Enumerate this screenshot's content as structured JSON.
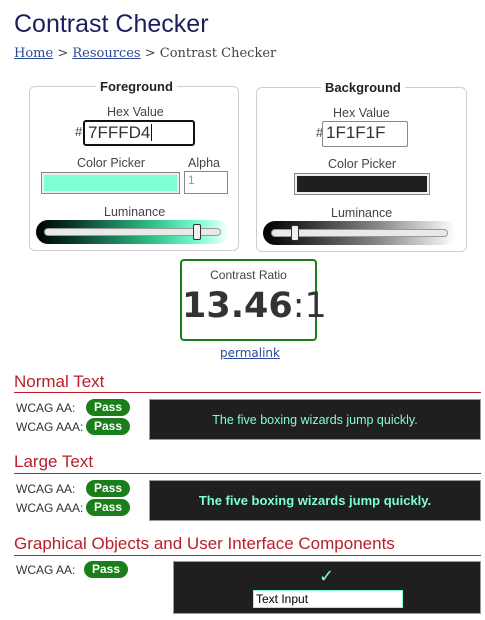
{
  "page": {
    "title": "Contrast Checker",
    "breadcrumb": {
      "home": "Home",
      "sep1": ">",
      "resources": "Resources",
      "sep2": ">",
      "current": "Contrast Checker"
    }
  },
  "foreground": {
    "legend": "Foreground",
    "hex_label": "Hex Value",
    "hash": "#",
    "hex_value": "7FFFD4",
    "picker_label": "Color Picker",
    "alpha_label": "Alpha",
    "alpha_placeholder": "1",
    "luminance_label": "Luminance",
    "luminance_level": 0.88,
    "color": "#7fffd4"
  },
  "background": {
    "legend": "Background",
    "hex_label": "Hex Value",
    "hash": "#",
    "hex_value": "1F1F1F",
    "picker_label": "Color Picker",
    "luminance_label": "Luminance",
    "luminance_level": 0.12,
    "color": "#1f1f1f"
  },
  "result": {
    "label": "Contrast Ratio",
    "ratio": "13.46",
    "colon": ":",
    "one": "1",
    "permalink": "permalink"
  },
  "sections": {
    "normal": {
      "title": "Normal Text",
      "aa": "WCAG AA:",
      "aaa": "WCAG AAA:",
      "aa_result": "Pass",
      "aaa_result": "Pass",
      "sample": "The five boxing wizards jump quickly."
    },
    "large": {
      "title": "Large Text",
      "aa": "WCAG AA:",
      "aaa": "WCAG AAA:",
      "aa_result": "Pass",
      "aaa_result": "Pass",
      "sample": "The five boxing wizards jump quickly."
    },
    "graphical": {
      "title": "Graphical Objects and User Interface Components",
      "aa": "WCAG AA:",
      "aa_result": "Pass",
      "check_glyph": "✓",
      "text_input": "Text Input"
    }
  },
  "colors": {
    "pass": "#1a7f1a",
    "heading_red": "#b8202a",
    "title_navy": "#1b1f5e",
    "link": "#2a4a99"
  }
}
